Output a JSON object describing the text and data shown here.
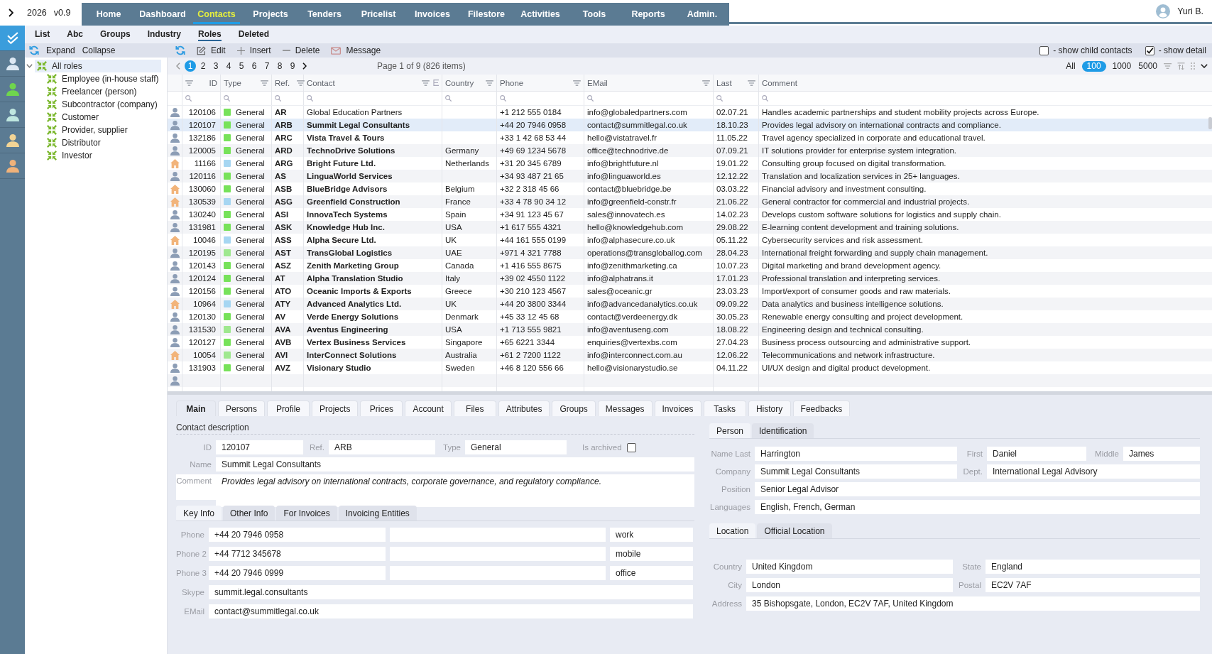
{
  "app": {
    "year": "2026",
    "version": "v0.9"
  },
  "nav": [
    {
      "label": "Home",
      "selected": false
    },
    {
      "label": "Dashboard",
      "selected": false
    },
    {
      "label": "Contacts",
      "selected": true
    },
    {
      "label": "Projects",
      "selected": false
    },
    {
      "label": "Tenders",
      "selected": false
    },
    {
      "label": "Pricelist",
      "selected": false
    },
    {
      "label": "Invoices",
      "selected": false
    },
    {
      "label": "Filestore",
      "selected": false
    },
    {
      "label": "Activities",
      "selected": false
    },
    {
      "label": "Tools",
      "selected": false
    },
    {
      "label": "Reports",
      "selected": false
    },
    {
      "label": "Admin.",
      "selected": false
    }
  ],
  "user": {
    "name": "Yuri B."
  },
  "sidebar": [
    {
      "kind": "check",
      "selected": true
    },
    {
      "kind": "person",
      "color": "#dce8f3",
      "selected": false
    },
    {
      "kind": "person",
      "color": "#6fd54d",
      "selected": false
    },
    {
      "kind": "person",
      "color": "#bfe7e0",
      "selected": false
    },
    {
      "kind": "person",
      "color": "#f3d495",
      "selected": false
    },
    {
      "kind": "person",
      "color": "#f0b27a",
      "selected": false
    }
  ],
  "view_tabs": [
    {
      "label": "List",
      "selected": false
    },
    {
      "label": "Abc",
      "selected": false
    },
    {
      "label": "Groups",
      "selected": false
    },
    {
      "label": "Industry",
      "selected": false
    },
    {
      "label": "Roles",
      "selected": true
    },
    {
      "label": "Deleted",
      "selected": false
    }
  ],
  "tree_toolbar": [
    {
      "kind": "refresh"
    },
    {
      "kind": "text",
      "label": "Expand"
    },
    {
      "kind": "text",
      "label": "Collapse"
    }
  ],
  "toolbar": {
    "buttons": [
      {
        "kind": "refresh"
      },
      {
        "kind": "edit",
        "label": "Edit"
      },
      {
        "kind": "insert",
        "label": "Insert"
      },
      {
        "kind": "delete",
        "label": "Delete"
      },
      {
        "kind": "message",
        "label": "Message"
      }
    ],
    "options": [
      {
        "label": "- show child contacts",
        "checked": false
      },
      {
        "label": "- show detail",
        "checked": true
      }
    ]
  },
  "tree": {
    "label": "All roles",
    "expanded": true,
    "selected": true,
    "children": [
      {
        "label": "Employee (in-house staff)",
        "selected": false
      },
      {
        "label": "Freelancer (person)",
        "selected": false
      },
      {
        "label": "Subcontractor (company)",
        "selected": false
      },
      {
        "label": "Customer",
        "selected": false
      },
      {
        "label": "Provider, supplier",
        "selected": false
      },
      {
        "label": "Distributor",
        "selected": false
      },
      {
        "label": "Investor",
        "selected": false
      }
    ]
  },
  "pagination": {
    "pages": [
      {
        "label": "1",
        "selected": true
      },
      {
        "label": "2",
        "selected": false
      },
      {
        "label": "3",
        "selected": false
      },
      {
        "label": "4",
        "selected": false
      },
      {
        "label": "5",
        "selected": false
      },
      {
        "label": "6",
        "selected": false
      },
      {
        "label": "7",
        "selected": false
      },
      {
        "label": "8",
        "selected": false
      },
      {
        "label": "9",
        "selected": false
      }
    ],
    "summary": "Page 1 of 9 (826 items)",
    "page_sizes": [
      {
        "label": "All",
        "selected": false
      },
      {
        "label": "100",
        "selected": true
      },
      {
        "label": "1000",
        "selected": false
      },
      {
        "label": "5000",
        "selected": false
      }
    ]
  },
  "table": {
    "columns": [
      {
        "label": "ID",
        "kind": "filter"
      },
      {
        "label": "Type",
        "kind": "filter"
      },
      {
        "label": "Ref.",
        "kind": "filter"
      },
      {
        "label": "Contact",
        "kind": "filter_menu"
      },
      {
        "label": "Country",
        "kind": "filter"
      },
      {
        "label": "Phone",
        "kind": "filter"
      },
      {
        "label": "EMail",
        "kind": "filter"
      },
      {
        "label": "Last",
        "kind": "filter"
      },
      {
        "label": "Comment",
        "kind": "plain"
      }
    ],
    "rows": [
      {
        "kind": "person",
        "id": "120106",
        "color": "#77e25a",
        "type": "General",
        "ref": "AR",
        "contact": "Global Education Partners",
        "bold": false,
        "phone": "+1 212 555 0184",
        "email": "info@globaledpartners.com",
        "last": "02.07.21",
        "comment": "Handles academic partnerships and student mobility projects across Europe.",
        "selected": false
      },
      {
        "kind": "person",
        "id": "120107",
        "color": "#77e25a",
        "type": "General",
        "ref": "ARB",
        "contact": "Summit Legal Consultants",
        "bold": true,
        "phone": "+44 20 7946 0958",
        "email": "contact@summitlegal.co.uk",
        "last": "18.10.23",
        "comment": "Provides legal advisory on international contracts and compliance.",
        "selected": true
      },
      {
        "kind": "person",
        "id": "132186",
        "color": "#77e25a",
        "type": "General",
        "ref": "ARC",
        "contact": "Vista Travel & Tours",
        "bold": true,
        "phone": "+33 1 42 68 53 44",
        "email": "hello@vistatravel.fr",
        "last": "11.05.22",
        "comment": "Travel agency specialized in corporate and educational travel.",
        "selected": false
      },
      {
        "kind": "person",
        "id": "120005",
        "color": "#77e25a",
        "type": "General",
        "ref": "ARD",
        "contact": "TechnoDrive Solutions",
        "bold": true,
        "country": "Germany",
        "phone": "+49 69 1234 5678",
        "email": "office@technodrive.de",
        "last": "07.09.21",
        "comment": "IT solutions provider for enterprise system integration.",
        "selected": false
      },
      {
        "kind": "house",
        "id": "11166",
        "color": "#a6d6f2",
        "type": "General",
        "ref": "ARG",
        "contact": "Bright Future Ltd.",
        "bold": true,
        "country": "Netherlands",
        "phone": "+31 20 345 6789",
        "email": "info@brightfuture.nl",
        "last": "19.01.22",
        "comment": "Consulting group focused on digital transformation.",
        "selected": false
      },
      {
        "kind": "person",
        "id": "120116",
        "color": "#77e25a",
        "type": "General",
        "ref": "AS",
        "contact": "LinguaWorld Services",
        "bold": true,
        "phone": "+34 93 487 21 65",
        "email": "info@linguaworld.es",
        "last": "12.12.22",
        "comment": "Translation and localization services in 25+ languages.",
        "selected": false
      },
      {
        "kind": "house",
        "id": "130060",
        "color": "#77e25a",
        "type": "General",
        "ref": "ASB",
        "contact": "BlueBridge Advisors",
        "bold": true,
        "country": "Belgium",
        "phone": "+32 2 318 45 66",
        "email": "contact@bluebridge.be",
        "last": "03.03.22",
        "comment": "Financial advisory and investment consulting.",
        "selected": false
      },
      {
        "kind": "house",
        "id": "130539",
        "color": "#a6d6f2",
        "type": "General",
        "ref": "ASG",
        "contact": "Greenfield Construction",
        "bold": true,
        "country": "France",
        "phone": "+33 4 78 90 34 12",
        "email": "info@greenfield-constr.fr",
        "last": "21.06.22",
        "comment": "General contractor for commercial and industrial projects.",
        "selected": false
      },
      {
        "kind": "person",
        "id": "130240",
        "color": "#77e25a",
        "type": "General",
        "ref": "ASI",
        "contact": "InnovaTech Systems",
        "bold": true,
        "country": "Spain",
        "phone": "+34 91 123 45 67",
        "email": "sales@innovatech.es",
        "last": "14.02.23",
        "comment": "Develops custom software solutions for logistics and supply chain.",
        "selected": false
      },
      {
        "kind": "person",
        "id": "131981",
        "color": "#77e25a",
        "type": "General",
        "ref": "ASK",
        "contact": "Knowledge Hub Inc.",
        "bold": true,
        "country": "USA",
        "phone": "+1 617 555 4321",
        "email": "hello@knowledgehub.com",
        "last": "29.08.22",
        "comment": "E-learning content development and training solutions.",
        "selected": false
      },
      {
        "kind": "house",
        "id": "10046",
        "color": "#a6d6f2",
        "type": "General",
        "ref": "ASS",
        "contact": "Alpha Secure Ltd.",
        "bold": true,
        "country": "UK",
        "phone": "+44 161 555 0199",
        "email": "info@alphasecure.co.uk",
        "last": "05.11.22",
        "comment": "Cybersecurity services and risk assessment.",
        "selected": false
      },
      {
        "kind": "person",
        "id": "120195",
        "color": "#9fe88f",
        "type": "General",
        "ref": "AST",
        "contact": "TransGlobal Logistics",
        "bold": true,
        "country": "UAE",
        "phone": "+971 4 321 7788",
        "email": "operations@transgloballog.com",
        "last": "28.04.23",
        "comment": "International freight forwarding and supply chain management.",
        "selected": false
      },
      {
        "kind": "person",
        "id": "120143",
        "color": "#77e25a",
        "type": "General",
        "ref": "ASZ",
        "contact": "Zenith Marketing Group",
        "bold": true,
        "country": "Canada",
        "phone": "+1 416 555 8675",
        "email": "info@zenithmarketing.ca",
        "last": "10.07.23",
        "comment": "Digital marketing and brand development agency.",
        "selected": false
      },
      {
        "kind": "person",
        "id": "120124",
        "color": "#77e25a",
        "type": "General",
        "ref": "AT",
        "contact": "Alpha Translation Studio",
        "bold": true,
        "country": "Italy",
        "phone": "+39 02 4550 1122",
        "email": "info@alphatrans.it",
        "last": "17.01.23",
        "comment": "Professional translation and interpreting services.",
        "selected": false
      },
      {
        "kind": "person",
        "id": "120156",
        "color": "#77e25a",
        "type": "General",
        "ref": "ATO",
        "contact": "Oceanic Imports & Exports",
        "bold": true,
        "country": "Greece",
        "phone": "+30 210 123 4567",
        "email": "sales@oceanic.gr",
        "last": "23.03.23",
        "comment": "Import/export of consumer goods and raw materials.",
        "selected": false
      },
      {
        "kind": "house",
        "id": "10964",
        "color": "#a6d6f2",
        "type": "General",
        "ref": "ATY",
        "contact": "Advanced Analytics Ltd.",
        "bold": true,
        "country": "UK",
        "phone": "+44 20 3800 3344",
        "email": "info@advancedanalytics.co.uk",
        "last": "09.09.22",
        "comment": "Data analytics and business intelligence solutions.",
        "selected": false
      },
      {
        "kind": "person",
        "id": "120130",
        "color": "#77e25a",
        "type": "General",
        "ref": "AV",
        "contact": "Verde Energy Solutions",
        "bold": true,
        "country": "Denmark",
        "phone": "+45 33 12 45 68",
        "email": "contact@verdeenergy.dk",
        "last": "30.05.23",
        "comment": "Renewable energy consulting and project development.",
        "selected": false
      },
      {
        "kind": "person",
        "id": "131530",
        "color": "#9fe88f",
        "type": "General",
        "ref": "AVA",
        "contact": "Aventus Engineering",
        "bold": true,
        "country": "USA",
        "phone": "+1 713 555 9821",
        "email": "info@aventuseng.com",
        "last": "18.08.22",
        "comment": "Engineering design and technical consulting.",
        "selected": false
      },
      {
        "kind": "person",
        "id": "120127",
        "color": "#77e25a",
        "type": "General",
        "ref": "AVB",
        "contact": "Vertex Business Services",
        "bold": true,
        "country": "Singapore",
        "phone": "+65 6221 3344",
        "email": "enquiries@vertexbs.com",
        "last": "27.04.23",
        "comment": "Business process outsourcing and administrative support.",
        "selected": false
      },
      {
        "kind": "house",
        "id": "10054",
        "color": "#9fe88f",
        "type": "General",
        "ref": "AVI",
        "contact": "InterConnect Solutions",
        "bold": true,
        "country": "Australia",
        "phone": "+61 2 7200 1122",
        "email": "info@interconnect.com.au",
        "last": "12.06.22",
        "comment": "Telecommunications and network infrastructure.",
        "selected": false
      },
      {
        "kind": "person",
        "id": "131903",
        "color": "#77e25a",
        "type": "General",
        "ref": "AVZ",
        "contact": "Visionary Studio",
        "bold": true,
        "country": "Sweden",
        "phone": "+46 8 120 556 66",
        "email": "hello@visionarystudio.se",
        "last": "04.11.22",
        "comment": "UI/UX design and digital product development.",
        "selected": false
      }
    ],
    "blank_rows": [
      {
        "kind": "person"
      }
    ]
  },
  "detail": {
    "tabs": [
      {
        "label": "Main",
        "selected": true
      },
      {
        "label": "Persons",
        "selected": false
      },
      {
        "label": "Profile",
        "selected": false
      },
      {
        "label": "Projects",
        "selected": false
      },
      {
        "label": "Prices",
        "selected": false
      },
      {
        "label": "Account",
        "selected": false
      },
      {
        "label": "Files",
        "selected": false
      },
      {
        "label": "Attributes",
        "selected": false
      },
      {
        "label": "Groups",
        "selected": false
      },
      {
        "label": "Messages",
        "selected": false
      },
      {
        "label": "Invoices",
        "selected": false
      },
      {
        "label": "Tasks",
        "selected": false
      },
      {
        "label": "History",
        "selected": false
      },
      {
        "label": "Feedbacks",
        "selected": false
      }
    ],
    "contact": {
      "title": "Contact description",
      "id": {
        "label": "ID",
        "value": "120107"
      },
      "ref": {
        "label": "Ref.",
        "value": "ARB"
      },
      "type": {
        "label": "Type",
        "value": "General"
      },
      "archived": {
        "label": "Is archived",
        "checked": false
      },
      "name": {
        "label": "Name",
        "value": "Summit Legal Consultants"
      },
      "comment": {
        "label": "Comment",
        "value": "Provides legal advisory on international contracts, corporate governance, and regulatory compliance."
      }
    },
    "info_tabs": [
      {
        "label": "Key Info",
        "selected": true
      },
      {
        "label": "Other Info",
        "selected": false
      },
      {
        "label": "For Invoices",
        "selected": false
      },
      {
        "label": "Invoicing Entities",
        "selected": false
      }
    ],
    "phones": [
      {
        "label": "Phone",
        "number": "+44 20 7946 0958",
        "category": "work"
      },
      {
        "label": "Phone 2",
        "number": "+44 7712 345678",
        "category": "mobile"
      },
      {
        "label": "Phone 3",
        "number": "+44 20 7946 0999",
        "category": "office"
      }
    ],
    "skype": {
      "label": "Skype",
      "value": "summit.legal.consultants"
    },
    "email": {
      "label": "EMail",
      "value": "contact@summitlegal.co.uk"
    },
    "person_tabs": [
      {
        "label": "Person",
        "selected": true
      },
      {
        "label": "Identification",
        "selected": false
      }
    ],
    "person": {
      "last": {
        "label": "Name Last",
        "value": "Harrington"
      },
      "first": {
        "label": "First",
        "value": "Daniel"
      },
      "middle": {
        "label": "Middle",
        "value": "James"
      },
      "company": {
        "label": "Company",
        "value": "Summit Legal Consultants"
      },
      "dept": {
        "label": "Dept.",
        "value": "International Legal Advisory"
      },
      "position": {
        "label": "Position",
        "value": "Senior Legal Advisor"
      },
      "languages": {
        "label": "Languages",
        "value": "English, French, German"
      }
    },
    "location_tabs": [
      {
        "label": "Location",
        "selected": true
      },
      {
        "label": "Official Location",
        "selected": false
      }
    ],
    "location": {
      "country": {
        "label": "Country",
        "value": "United Kingdom"
      },
      "state": {
        "label": "State",
        "value": "England"
      },
      "city": {
        "label": "City",
        "value": "London"
      },
      "postal": {
        "label": "Postal",
        "value": "EC2V 7AF"
      },
      "address": {
        "label": "Address",
        "value": "35 Bishopsgate, London, EC2V 7AF, United Kingdom"
      }
    }
  }
}
